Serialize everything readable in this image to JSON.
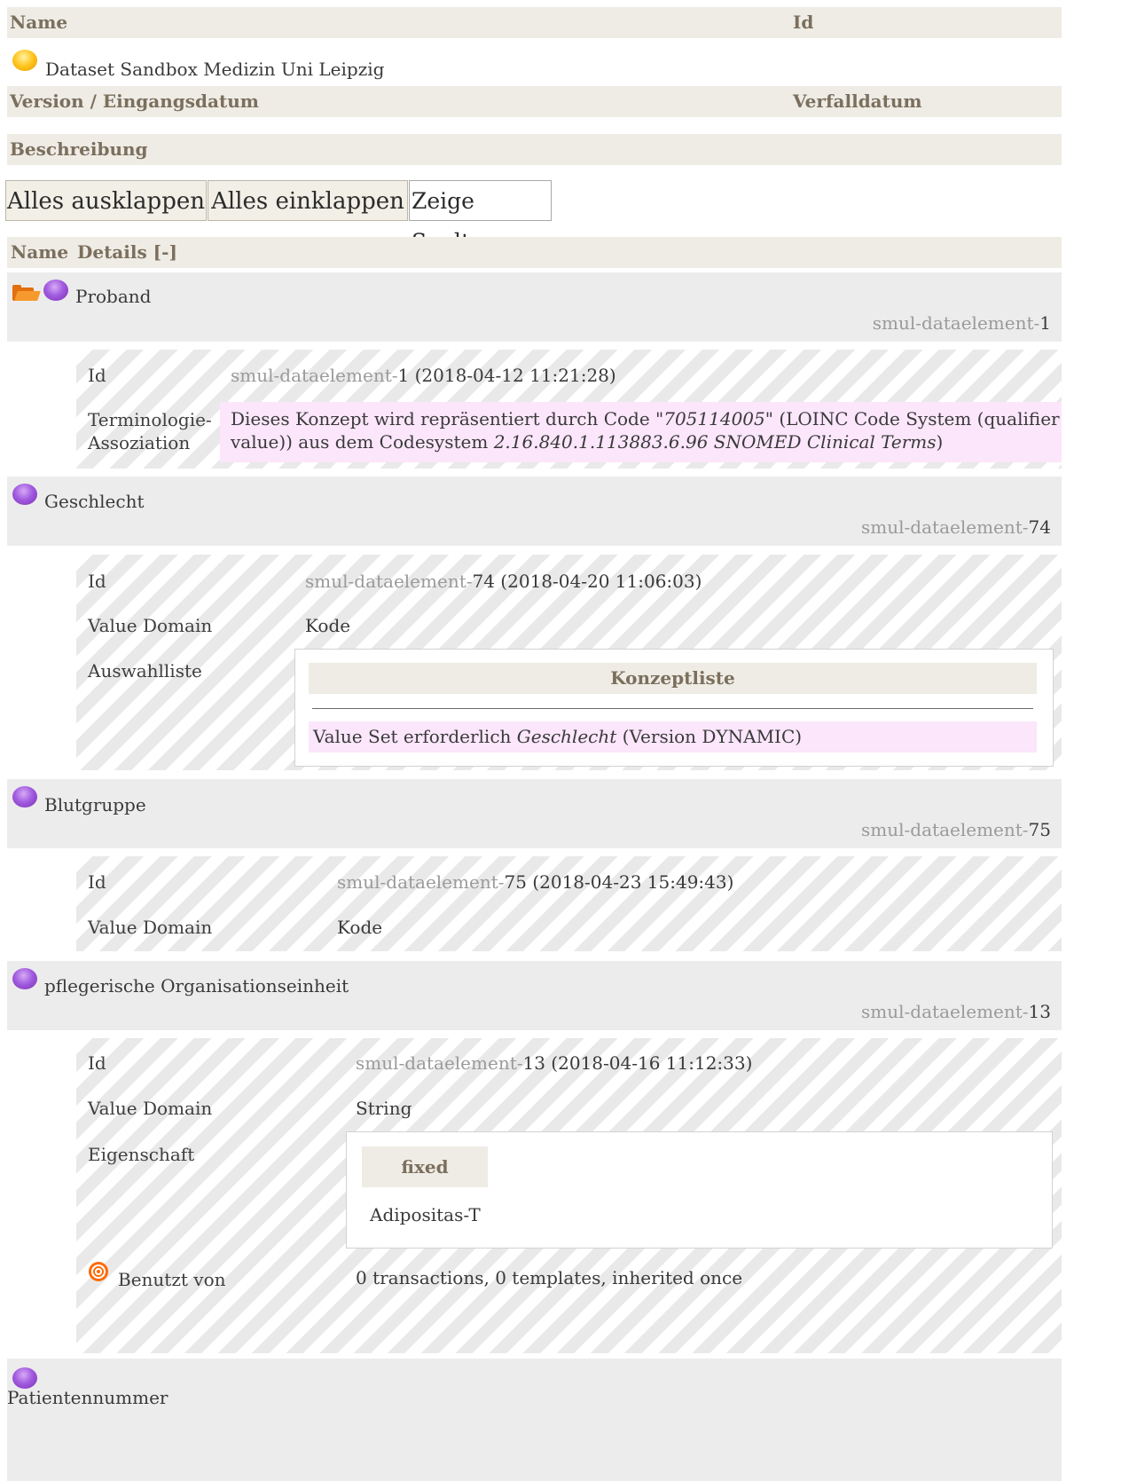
{
  "dataset": {
    "header_name": "Name",
    "header_id": "Id",
    "name": "Dataset Sandbox Medizin Uni Leipzig",
    "header_version": "Version / Eingangsdatum",
    "header_expiry": "Verfalldatum",
    "header_description": "Beschreibung"
  },
  "toolbar": {
    "expand_all": "Alles ausklappen",
    "collapse_all": "Alles einklappen",
    "show_column": "Zeige Spalte..."
  },
  "table": {
    "col_name": "Name",
    "col_details": "Details [-]"
  },
  "concepts": {
    "proband": {
      "name": "Proband",
      "id_prefix": "smul-dataelement-",
      "id_num": "1",
      "row_id_label": "Id",
      "row_id_date": " (2018-04-12 11:21:28)",
      "terminology_label_1": "Terminologie-",
      "terminology_label_2": "Assoziation",
      "terminology_text_1": "Dieses Konzept wird repräsentiert durch Code \"",
      "terminology_code": "705114005",
      "terminology_text_2": "\" (LOINC Code System (qualifier",
      "terminology_text_3": "value)) aus dem Codesystem ",
      "terminology_system": "2.16.840.1.113883.6.96 SNOMED Clinical Terms",
      "terminology_text_4": ")"
    },
    "geschlecht": {
      "name": "Geschlecht",
      "id_prefix": "smul-dataelement-",
      "id_num": "74",
      "row_id_label": "Id",
      "row_id_date": " (2018-04-20 11:06:03)",
      "value_domain_label": "Value Domain",
      "value_domain": "Kode",
      "choice_label": "Auswahlliste",
      "concept_list_header": "Konzeptliste",
      "valueset_text_1": "Value Set erforderlich ",
      "valueset_name": "Geschlecht",
      "valueset_text_2": " (Version DYNAMIC)"
    },
    "blutgruppe": {
      "name": "Blutgruppe",
      "id_prefix": "smul-dataelement-",
      "id_num": "75",
      "row_id_label": "Id",
      "row_id_date": " (2018-04-23 15:49:43)",
      "value_domain_label": "Value Domain",
      "value_domain": "Kode"
    },
    "pflege": {
      "name": "pflegerische Organisationseinheit",
      "id_prefix": "smul-dataelement-",
      "id_num": "13",
      "row_id_label": "Id",
      "row_id_date": " (2018-04-16 11:12:33)",
      "value_domain_label": "Value Domain",
      "value_domain": "String",
      "property_label": "Eigenschaft",
      "property_fixed_label": "fixed",
      "property_value": "Adipositas-T",
      "used_by_label": "Benutzt von",
      "used_by_value": "0 transactions, 0 templates, inherited once"
    },
    "patientennummer": {
      "name": "Patientennummer"
    }
  }
}
